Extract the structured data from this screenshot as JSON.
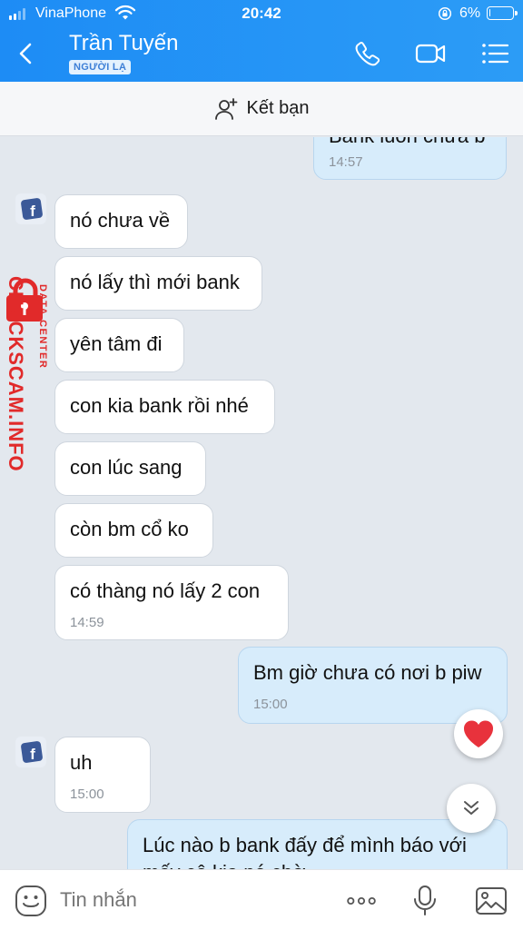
{
  "status_bar": {
    "carrier": "VinaPhone",
    "time": "20:42",
    "battery": "6%",
    "battery_level": 0.06
  },
  "header": {
    "contact_name": "Trần Tuyến",
    "badge": "NGƯỜI LẠ"
  },
  "add_friend": {
    "label": "Kết bạn"
  },
  "messages": [
    {
      "dir": "out",
      "text": "Bank luôn chưa b",
      "time": "14:57"
    },
    {
      "dir": "in",
      "text": "nó chưa về"
    },
    {
      "dir": "in",
      "text": "nó lấy thì mới bank"
    },
    {
      "dir": "in",
      "text": "yên tâm đi"
    },
    {
      "dir": "in",
      "text": "con kia bank rồi nhé"
    },
    {
      "dir": "in",
      "text": "con lúc sang"
    },
    {
      "dir": "in",
      "text": "còn bm cổ ko"
    },
    {
      "dir": "in",
      "text": "có thàng nó lấy 2 con",
      "time": "14:59"
    },
    {
      "dir": "out",
      "text": "Bm giờ chưa có nơi b piw",
      "time": "15:00"
    },
    {
      "dir": "in",
      "text": "uh",
      "time": "15:00"
    },
    {
      "dir": "out",
      "text": "Lúc nào b bank đấy để mình báo với",
      "text2": "mấy cô kia nó chờ"
    }
  ],
  "watermark": {
    "brand": "CHECKSCAM.INFO",
    "sub": "DATA CENTER"
  },
  "input": {
    "placeholder": "Tin nhắn"
  },
  "colors": {
    "header": "#1d8cf5",
    "bubble_out": "#d7ecfb",
    "bubble_in": "#ffffff",
    "chat_bg": "#e3e8ee",
    "watermark": "#e12a2a"
  },
  "icons": [
    "back-arrow-icon",
    "phone-icon",
    "video-camera-icon",
    "list-menu-icon",
    "add-user-icon",
    "heart-icon",
    "chevron-double-down-icon",
    "emoji-icon",
    "more-dots-icon",
    "microphone-icon",
    "image-icon"
  ]
}
